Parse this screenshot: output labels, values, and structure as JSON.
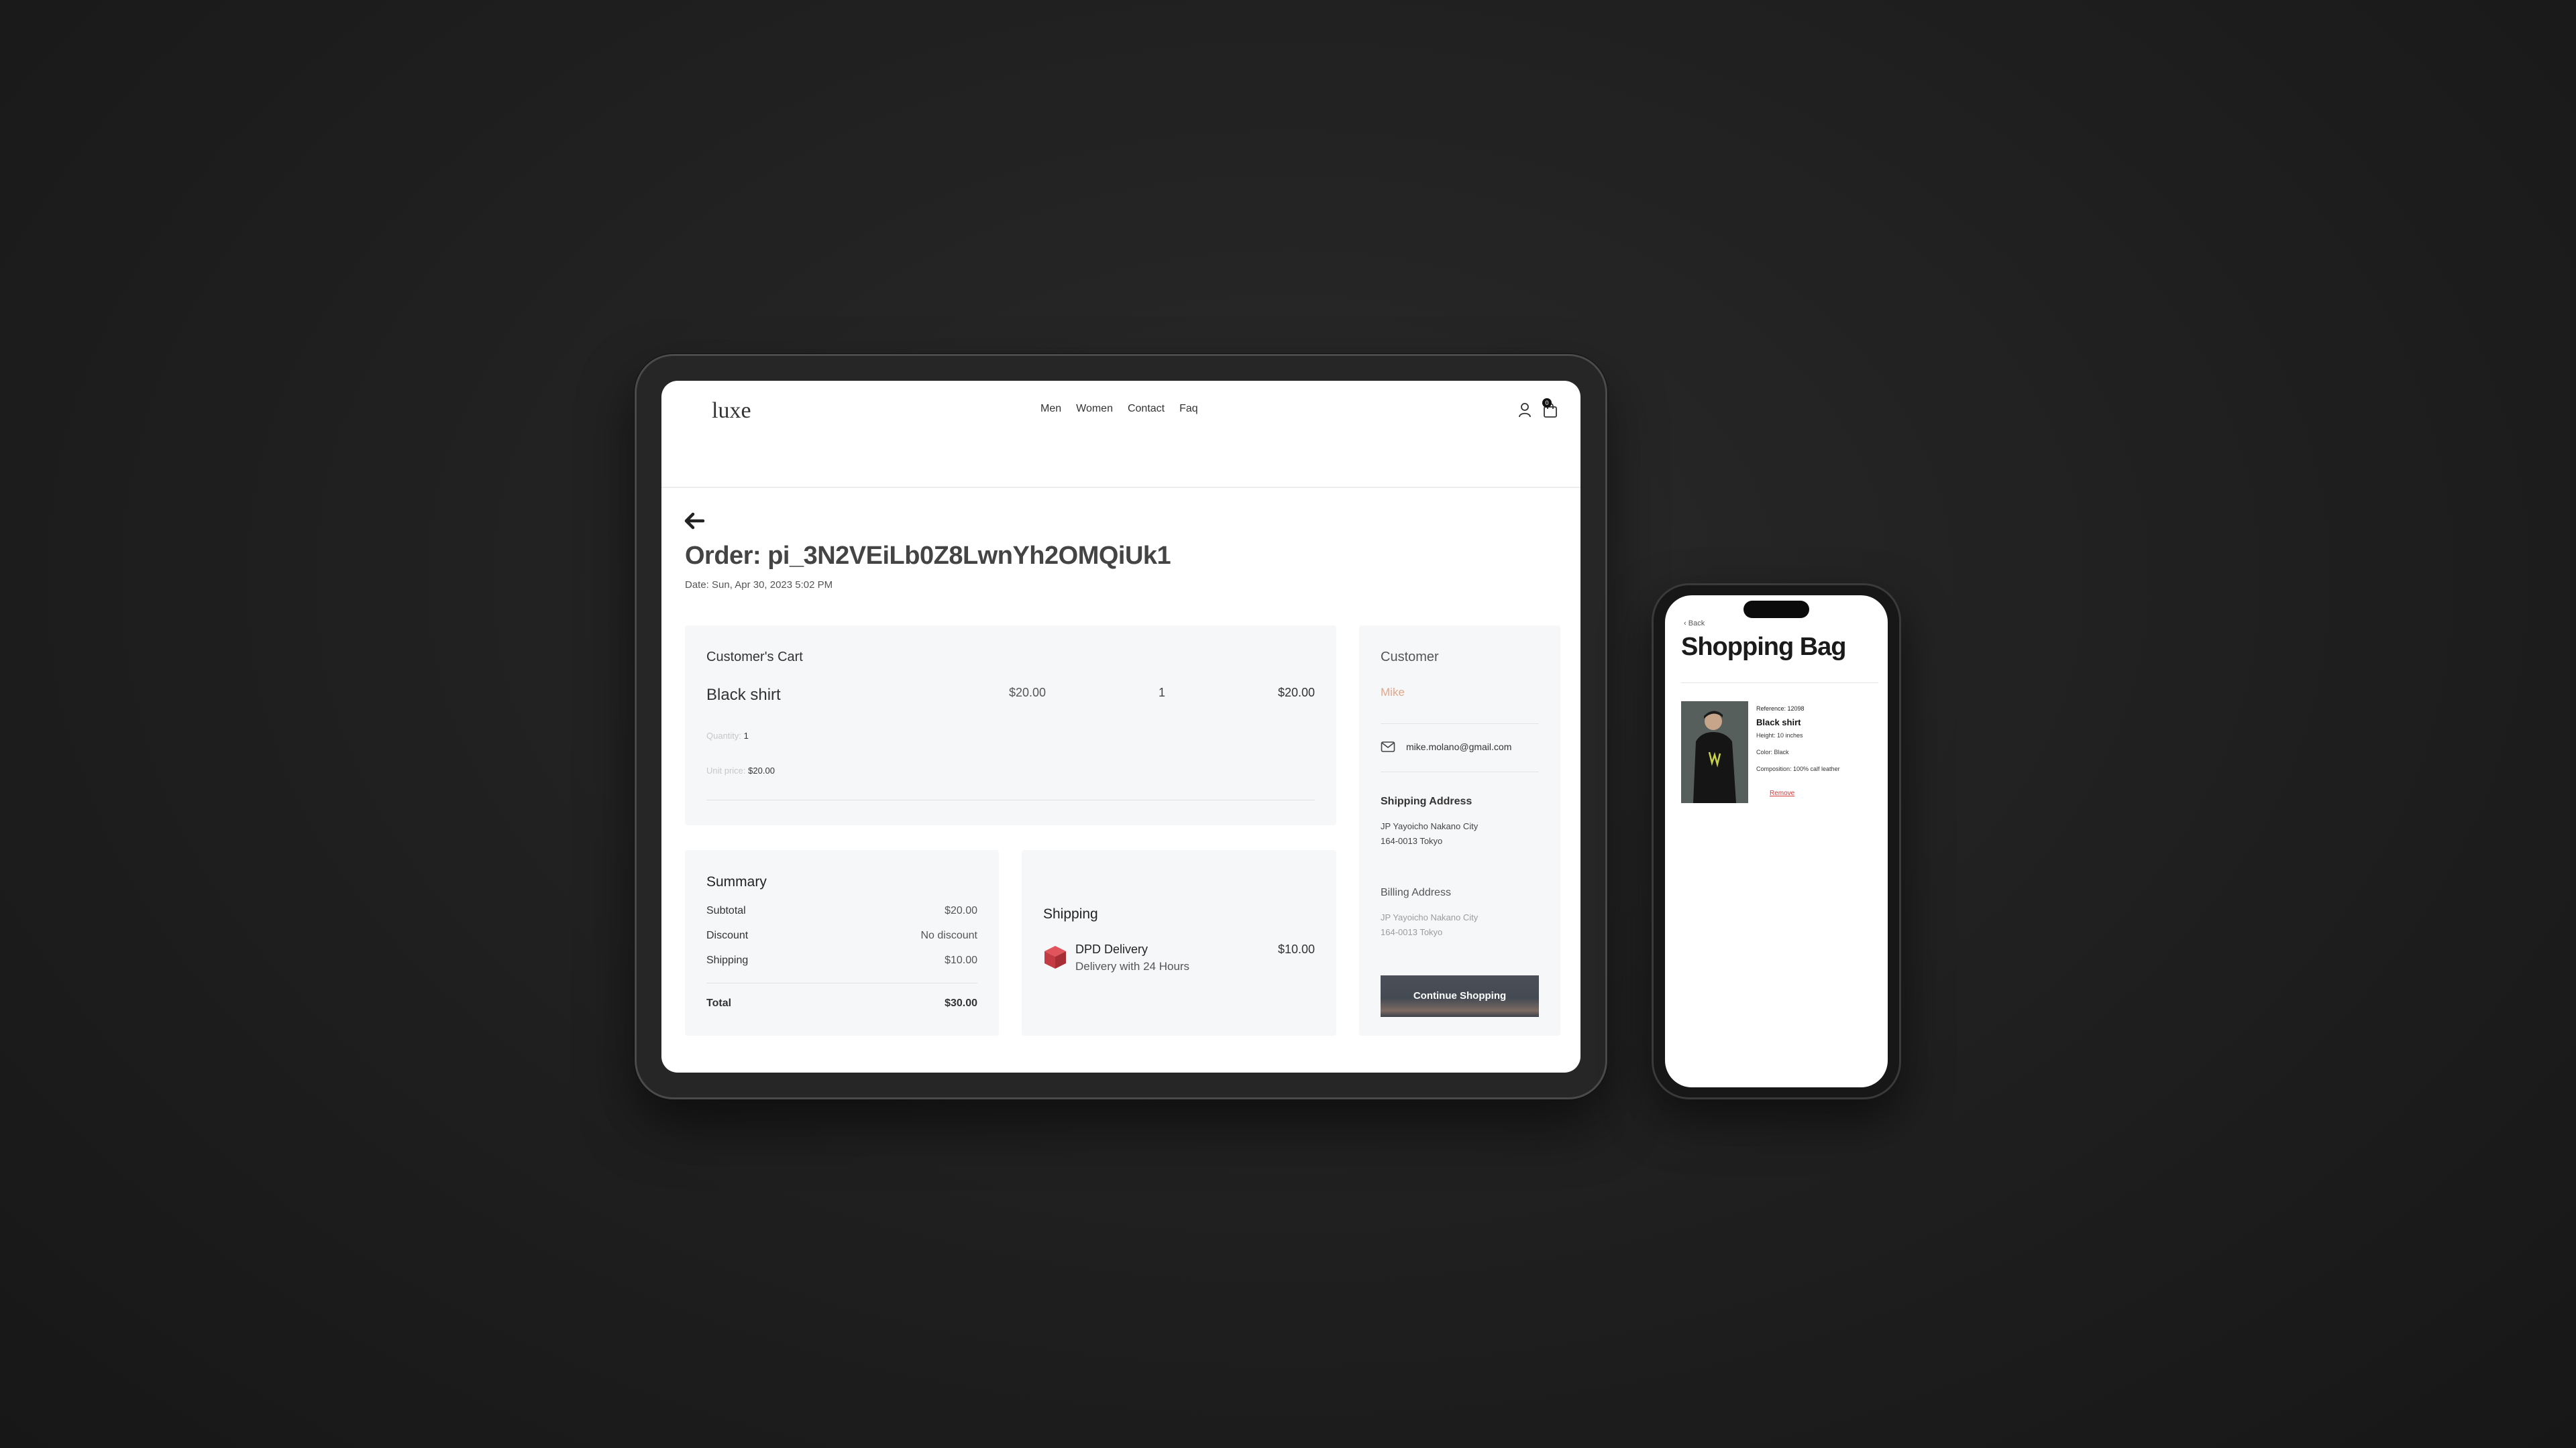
{
  "tablet": {
    "nav": {
      "logo": "luxe",
      "links": [
        "Men",
        "Women",
        "Contact",
        "Faq"
      ],
      "cart_count": "0"
    },
    "order": {
      "title": "Order: pi_3N2VEiLb0Z8LwnYh2OMQiUk1",
      "date": "Date: Sun, Apr 30, 2023 5:02 PM"
    },
    "cart": {
      "title": "Customer's Cart",
      "item": {
        "name": "Black shirt",
        "price": "$20.00",
        "quantity": "1",
        "total": "$20.00",
        "quantity_label": "Quantity:",
        "unit_price_label": "Unit price:",
        "unit_price": "$20.00"
      }
    },
    "summary": {
      "title": "Summary",
      "rows": [
        {
          "label": "Subtotal",
          "value": "$20.00"
        },
        {
          "label": "Discount",
          "value": "No discount"
        },
        {
          "label": "Shipping",
          "value": "$10.00"
        }
      ],
      "total_label": "Total",
      "total_value": "$30.00"
    },
    "shipping": {
      "title": "Shipping",
      "method": "DPD Delivery",
      "description": "Delivery with 24 Hours",
      "price": "$10.00"
    },
    "customer": {
      "title": "Customer",
      "name": "Mike",
      "email": "mike.molano@gmail.com",
      "shipping_address_title": "Shipping Address",
      "shipping_address": [
        "JP Yayoicho Nakano City",
        "164-0013 Tokyo"
      ],
      "billing_address_title": "Billing Address",
      "billing_address": [
        "JP Yayoicho Nakano City",
        "164-0013 Tokyo"
      ],
      "continue_label": "Continue Shopping"
    }
  },
  "phone": {
    "back_label": "Back",
    "title": "Shopping Bag",
    "item": {
      "reference": "Reference: 12098",
      "name": "Black shirt",
      "height": "Height: 10 inches",
      "color": "Color: Black",
      "composition": "Composition: 100% calf leather",
      "remove_label": "Remove"
    }
  },
  "colors": {
    "background": "#1f1f1f",
    "accent_name": "#e0a88c",
    "remove": "#d23c3c",
    "button": "#444a52"
  },
  "icons": [
    "back-arrow-icon",
    "user-icon",
    "shopping-bag-icon",
    "package-icon",
    "mail-icon",
    "chevron-left-icon"
  ]
}
